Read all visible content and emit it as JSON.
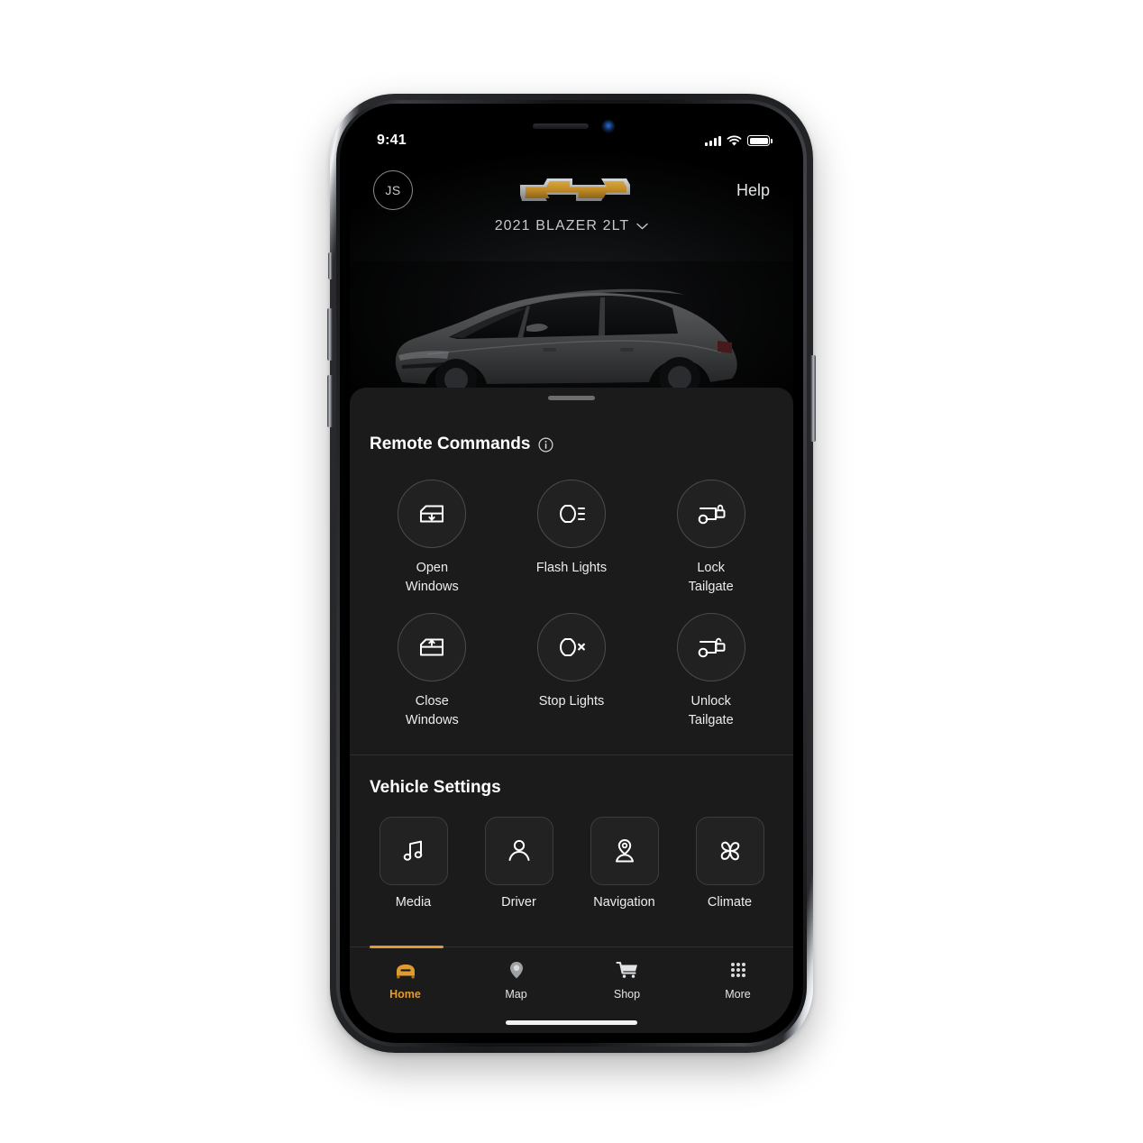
{
  "status_bar": {
    "time": "9:41",
    "signal_icon": "cellular-signal-icon",
    "wifi_icon": "wifi-icon",
    "battery_icon": "battery-full-icon"
  },
  "header": {
    "avatar_initials": "JS",
    "brand_logo": "chevrolet-bowtie-logo",
    "help_label": "Help",
    "vehicle_name": "2021 BLAZER 2LT",
    "vehicle_chevron_icon": "chevron-down-icon"
  },
  "hero": {
    "vehicle_image": "chevrolet-blazer-side-view"
  },
  "sheet": {
    "grabber": "drag-handle",
    "remote_commands": {
      "title": "Remote Commands",
      "info_icon": "info-circle-icon",
      "items": [
        {
          "label": "Open\nWindows",
          "icon": "window-down-icon"
        },
        {
          "label": "Flash Lights",
          "icon": "headlight-beam-icon"
        },
        {
          "label": "Lock\nTailgate",
          "icon": "tailgate-lock-icon"
        },
        {
          "label": "Close\nWindows",
          "icon": "window-up-icon"
        },
        {
          "label": "Stop Lights",
          "icon": "headlight-off-icon"
        },
        {
          "label": "Unlock\nTailgate",
          "icon": "tailgate-unlock-icon"
        }
      ]
    },
    "vehicle_settings": {
      "title": "Vehicle Settings",
      "items": [
        {
          "label": "Media",
          "icon": "music-note-icon"
        },
        {
          "label": "Driver",
          "icon": "driver-person-icon"
        },
        {
          "label": "Navigation",
          "icon": "map-pin-person-icon"
        },
        {
          "label": "Climate",
          "icon": "fan-blades-icon"
        }
      ]
    }
  },
  "tab_bar": {
    "active_index": 0,
    "accent_color": "#e09a2f",
    "items": [
      {
        "label": "Home",
        "icon": "car-front-icon"
      },
      {
        "label": "Map",
        "icon": "location-pin-icon"
      },
      {
        "label": "Shop",
        "icon": "shopping-cart-icon"
      },
      {
        "label": "More",
        "icon": "grid-dots-icon"
      }
    ]
  },
  "theme": {
    "background": "#000000",
    "sheet_background": "#1b1b1b",
    "accent": "#e09a2f",
    "text_primary": "#ffffff",
    "text_secondary": "#c6c8ca"
  }
}
